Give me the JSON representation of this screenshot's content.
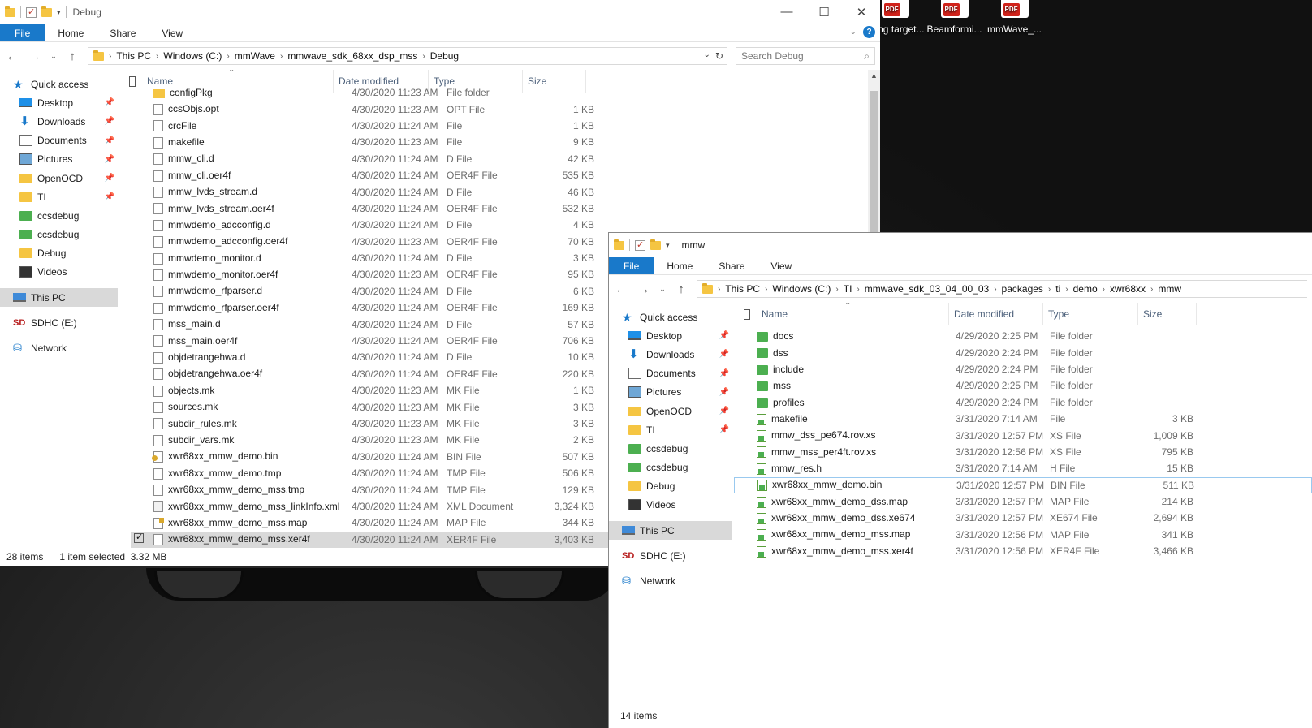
{
  "desktop": {
    "icons": [
      {
        "label": "cking target...",
        "badge": "PDF"
      },
      {
        "label": "Beamformi...",
        "badge": "PDF"
      },
      {
        "label": "mmWave_...",
        "badge": "PDF"
      }
    ]
  },
  "win1": {
    "title": "Debug",
    "ribbon": {
      "file": "File",
      "home": "Home",
      "share": "Share",
      "view": "View"
    },
    "address": [
      "This PC",
      "Windows (C:)",
      "mmWave",
      "mmwave_sdk_68xx_dsp_mss",
      "Debug"
    ],
    "search_placeholder": "Search Debug",
    "columns": {
      "name": "Name",
      "date": "Date modified",
      "type": "Type",
      "size": "Size"
    },
    "sidebar": [
      {
        "label": "Quick access",
        "icon": "star-icon",
        "level": 0
      },
      {
        "label": "Desktop",
        "icon": "desktop-icon",
        "pin": true
      },
      {
        "label": "Downloads",
        "icon": "downloads-icon",
        "pin": true
      },
      {
        "label": "Documents",
        "icon": "documents-icon",
        "pin": true
      },
      {
        "label": "Pictures",
        "icon": "pictures-icon",
        "pin": true
      },
      {
        "label": "OpenOCD",
        "icon": "folder-icon",
        "pin": true
      },
      {
        "label": "TI",
        "icon": "folder-icon",
        "pin": true
      },
      {
        "label": "ccsdebug",
        "icon": "ccs-folder-icon"
      },
      {
        "label": "ccsdebug",
        "icon": "ccs-folder-icon"
      },
      {
        "label": "Debug",
        "icon": "folder-icon"
      },
      {
        "label": "Videos",
        "icon": "videos-icon"
      },
      {
        "label": "This PC",
        "icon": "this-pc-icon",
        "level": 0,
        "selected": true
      },
      {
        "label": "SDHC (E:)",
        "icon": "sd-card-icon",
        "level": 0
      },
      {
        "label": "Network",
        "icon": "network-icon",
        "level": 0
      }
    ],
    "files": [
      {
        "name": "configPkg",
        "date": "4/30/2020 11:23 AM",
        "type": "File folder",
        "size": "",
        "icon": "folder"
      },
      {
        "name": "ccsObjs.opt",
        "date": "4/30/2020 11:23 AM",
        "type": "OPT File",
        "size": "1 KB",
        "icon": "file"
      },
      {
        "name": "crcFile",
        "date": "4/30/2020 11:24 AM",
        "type": "File",
        "size": "1 KB",
        "icon": "file"
      },
      {
        "name": "makefile",
        "date": "4/30/2020 11:23 AM",
        "type": "File",
        "size": "9 KB",
        "icon": "file"
      },
      {
        "name": "mmw_cli.d",
        "date": "4/30/2020 11:24 AM",
        "type": "D File",
        "size": "42 KB",
        "icon": "file"
      },
      {
        "name": "mmw_cli.oer4f",
        "date": "4/30/2020 11:24 AM",
        "type": "OER4F File",
        "size": "535 KB",
        "icon": "file"
      },
      {
        "name": "mmw_lvds_stream.d",
        "date": "4/30/2020 11:24 AM",
        "type": "D File",
        "size": "46 KB",
        "icon": "file"
      },
      {
        "name": "mmw_lvds_stream.oer4f",
        "date": "4/30/2020 11:24 AM",
        "type": "OER4F File",
        "size": "532 KB",
        "icon": "file"
      },
      {
        "name": "mmwdemo_adcconfig.d",
        "date": "4/30/2020 11:24 AM",
        "type": "D File",
        "size": "4 KB",
        "icon": "file"
      },
      {
        "name": "mmwdemo_adcconfig.oer4f",
        "date": "4/30/2020 11:23 AM",
        "type": "OER4F File",
        "size": "70 KB",
        "icon": "file"
      },
      {
        "name": "mmwdemo_monitor.d",
        "date": "4/30/2020 11:24 AM",
        "type": "D File",
        "size": "3 KB",
        "icon": "file"
      },
      {
        "name": "mmwdemo_monitor.oer4f",
        "date": "4/30/2020 11:23 AM",
        "type": "OER4F File",
        "size": "95 KB",
        "icon": "file"
      },
      {
        "name": "mmwdemo_rfparser.d",
        "date": "4/30/2020 11:24 AM",
        "type": "D File",
        "size": "6 KB",
        "icon": "file"
      },
      {
        "name": "mmwdemo_rfparser.oer4f",
        "date": "4/30/2020 11:24 AM",
        "type": "OER4F File",
        "size": "169 KB",
        "icon": "file"
      },
      {
        "name": "mss_main.d",
        "date": "4/30/2020 11:24 AM",
        "type": "D File",
        "size": "57 KB",
        "icon": "file"
      },
      {
        "name": "mss_main.oer4f",
        "date": "4/30/2020 11:24 AM",
        "type": "OER4F File",
        "size": "706 KB",
        "icon": "file"
      },
      {
        "name": "objdetrangehwa.d",
        "date": "4/30/2020 11:24 AM",
        "type": "D File",
        "size": "10 KB",
        "icon": "file"
      },
      {
        "name": "objdetrangehwa.oer4f",
        "date": "4/30/2020 11:24 AM",
        "type": "OER4F File",
        "size": "220 KB",
        "icon": "file"
      },
      {
        "name": "objects.mk",
        "date": "4/30/2020 11:23 AM",
        "type": "MK File",
        "size": "1 KB",
        "icon": "file"
      },
      {
        "name": "sources.mk",
        "date": "4/30/2020 11:23 AM",
        "type": "MK File",
        "size": "3 KB",
        "icon": "file"
      },
      {
        "name": "subdir_rules.mk",
        "date": "4/30/2020 11:23 AM",
        "type": "MK File",
        "size": "3 KB",
        "icon": "file"
      },
      {
        "name": "subdir_vars.mk",
        "date": "4/30/2020 11:23 AM",
        "type": "MK File",
        "size": "2 KB",
        "icon": "file"
      },
      {
        "name": "xwr68xx_mmw_demo.bin",
        "date": "4/30/2020 11:24 AM",
        "type": "BIN File",
        "size": "507 KB",
        "icon": "bin"
      },
      {
        "name": "xwr68xx_mmw_demo.tmp",
        "date": "4/30/2020 11:24 AM",
        "type": "TMP File",
        "size": "506 KB",
        "icon": "file"
      },
      {
        "name": "xwr68xx_mmw_demo_mss.tmp",
        "date": "4/30/2020 11:24 AM",
        "type": "TMP File",
        "size": "129 KB",
        "icon": "file"
      },
      {
        "name": "xwr68xx_mmw_demo_mss_linkInfo.xml",
        "date": "4/30/2020 11:24 AM",
        "type": "XML Document",
        "size": "3,324 KB",
        "icon": "xml"
      },
      {
        "name": "xwr68xx_mmw_demo_mss.map",
        "date": "4/30/2020 11:24 AM",
        "type": "MAP File",
        "size": "344 KB",
        "icon": "map"
      },
      {
        "name": "xwr68xx_mmw_demo_mss.xer4f",
        "date": "4/30/2020 11:24 AM",
        "type": "XER4F File",
        "size": "3,403 KB",
        "icon": "file",
        "selected": true
      }
    ],
    "status": {
      "count": "28 items",
      "selection": "1 item selected",
      "size": "3.32 MB"
    }
  },
  "win2": {
    "title": "mmw",
    "ribbon": {
      "file": "File",
      "home": "Home",
      "share": "Share",
      "view": "View"
    },
    "address": [
      "This PC",
      "Windows (C:)",
      "TI",
      "mmwave_sdk_03_04_00_03",
      "packages",
      "ti",
      "demo",
      "xwr68xx",
      "mmw"
    ],
    "columns": {
      "name": "Name",
      "date": "Date modified",
      "type": "Type",
      "size": "Size"
    },
    "sidebar": [
      {
        "label": "Quick access",
        "icon": "star-icon",
        "level": 0
      },
      {
        "label": "Desktop",
        "icon": "desktop-icon",
        "pin": true
      },
      {
        "label": "Downloads",
        "icon": "downloads-icon",
        "pin": true
      },
      {
        "label": "Documents",
        "icon": "documents-icon",
        "pin": true
      },
      {
        "label": "Pictures",
        "icon": "pictures-icon",
        "pin": true
      },
      {
        "label": "OpenOCD",
        "icon": "folder-icon",
        "pin": true
      },
      {
        "label": "TI",
        "icon": "folder-icon",
        "pin": true
      },
      {
        "label": "ccsdebug",
        "icon": "ccs-folder-icon"
      },
      {
        "label": "ccsdebug",
        "icon": "ccs-folder-icon"
      },
      {
        "label": "Debug",
        "icon": "folder-icon"
      },
      {
        "label": "Videos",
        "icon": "videos-icon"
      },
      {
        "label": "This PC",
        "icon": "this-pc-icon",
        "level": 0,
        "selected": true
      },
      {
        "label": "SDHC (E:)",
        "icon": "sd-card-icon",
        "level": 0
      },
      {
        "label": "Network",
        "icon": "network-icon",
        "level": 0
      }
    ],
    "files": [
      {
        "name": "docs",
        "date": "4/29/2020 2:25 PM",
        "type": "File folder",
        "size": "",
        "icon": "ccsf"
      },
      {
        "name": "dss",
        "date": "4/29/2020 2:24 PM",
        "type": "File folder",
        "size": "",
        "icon": "ccsf"
      },
      {
        "name": "include",
        "date": "4/29/2020 2:24 PM",
        "type": "File folder",
        "size": "",
        "icon": "ccsf"
      },
      {
        "name": "mss",
        "date": "4/29/2020 2:25 PM",
        "type": "File folder",
        "size": "",
        "icon": "ccsf"
      },
      {
        "name": "profiles",
        "date": "4/29/2020 2:24 PM",
        "type": "File folder",
        "size": "",
        "icon": "ccsf"
      },
      {
        "name": "makefile",
        "date": "3/31/2020 7:14 AM",
        "type": "File",
        "size": "3 KB",
        "icon": "green"
      },
      {
        "name": "mmw_dss_pe674.rov.xs",
        "date": "3/31/2020 12:57 PM",
        "type": "XS File",
        "size": "1,009 KB",
        "icon": "green"
      },
      {
        "name": "mmw_mss_per4ft.rov.xs",
        "date": "3/31/2020 12:56 PM",
        "type": "XS File",
        "size": "795 KB",
        "icon": "green"
      },
      {
        "name": "mmw_res.h",
        "date": "3/31/2020 7:14 AM",
        "type": "H File",
        "size": "15 KB",
        "icon": "green"
      },
      {
        "name": "xwr68xx_mmw_demo.bin",
        "date": "3/31/2020 12:57 PM",
        "type": "BIN File",
        "size": "511 KB",
        "icon": "green",
        "focus": true
      },
      {
        "name": "xwr68xx_mmw_demo_dss.map",
        "date": "3/31/2020 12:57 PM",
        "type": "MAP File",
        "size": "214 KB",
        "icon": "green"
      },
      {
        "name": "xwr68xx_mmw_demo_dss.xe674",
        "date": "3/31/2020 12:57 PM",
        "type": "XE674 File",
        "size": "2,694 KB",
        "icon": "green"
      },
      {
        "name": "xwr68xx_mmw_demo_mss.map",
        "date": "3/31/2020 12:56 PM",
        "type": "MAP File",
        "size": "341 KB",
        "icon": "green"
      },
      {
        "name": "xwr68xx_mmw_demo_mss.xer4f",
        "date": "3/31/2020 12:56 PM",
        "type": "XER4F File",
        "size": "3,466 KB",
        "icon": "green"
      }
    ],
    "status": {
      "count": "14 items"
    }
  }
}
